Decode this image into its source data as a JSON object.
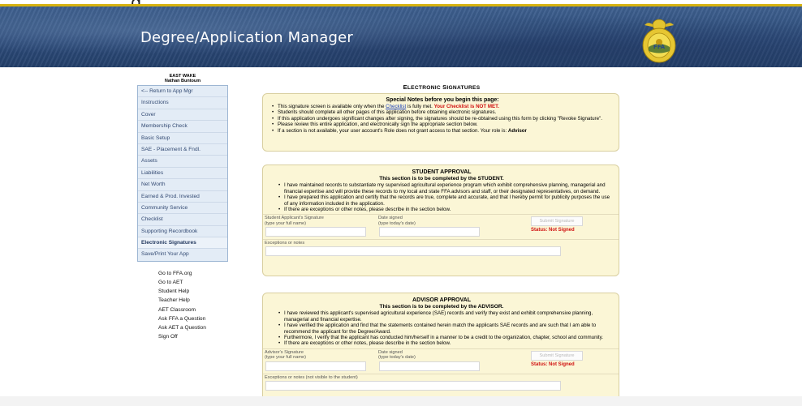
{
  "browser": {
    "title_fragment": "g"
  },
  "header": {
    "title": "Degree/Application Manager",
    "emblem": "ffa-emblem"
  },
  "sidebar": {
    "school": "EAST WAKE",
    "person": "Nathan Buntoum",
    "items": [
      {
        "label": "<-- Return to App Mgr"
      },
      {
        "label": "Instructions"
      },
      {
        "label": "Cover"
      },
      {
        "label": "Membership Check"
      },
      {
        "label": "Basic Setup"
      },
      {
        "label": "SAE - Placement & Fndl."
      },
      {
        "label": "Assets"
      },
      {
        "label": "Liabilities"
      },
      {
        "label": "Net Worth"
      },
      {
        "label": "Earned & Prod. Invested"
      },
      {
        "label": "Community Service"
      },
      {
        "label": "Checklist"
      },
      {
        "label": "Supporting Recordbook"
      },
      {
        "label": "Electronic Signatures",
        "active": true
      },
      {
        "label": "Save/Print Your App"
      }
    ],
    "links": [
      {
        "label": "Go to FFA.org"
      },
      {
        "label": "Go to AET"
      },
      {
        "label": "Student Help"
      },
      {
        "label": "Teacher Help"
      },
      {
        "label": "AET Classroom"
      },
      {
        "label": "Ask FFA a Question"
      },
      {
        "label": "Ask AET a Question"
      },
      {
        "label": "Sign Off"
      }
    ]
  },
  "main": {
    "title_first": "E",
    "title_rest": "LECTRONIC ",
    "title_first2": "S",
    "title_rest2": "IGNATURES",
    "notes": {
      "heading": "Special Notes before you begin this page:",
      "b1_pre": "This signature screen is available only when the ",
      "b1_link": "Checklist",
      "b1_mid": " is fully met. ",
      "b1_red": "Your Checklist is NOT MET.",
      "b2": "Students should complete all other pages of this application before obtaining electronic signatures.",
      "b3": "If this application undergoes significant changes after signing, the signatures should be re-obtained using this form by clicking \"Revoke Signature\".",
      "b4": "Please review this entire application, and electronically sign the appropriate section below.",
      "b5_pre": "If a section is not available, your user account's Role does not grant access to that section. Your role is: ",
      "b5_role": "Advisor"
    },
    "student": {
      "heading": "STUDENT APPROVAL",
      "sub": "This section is to be completed by the STUDENT.",
      "b1": "I have maintained records to substantiate my supervised agricultural experience program which exhibit comprehensive planning, managerial and financial expertise and will provide these records to my local and state FFA advisors and staff, or their designated representatives, on demand.",
      "b2": "I have prepared this application and certify that the records are true, complete and accurate, and that I hereby permit for publicity purposes the use of any information included in the application.",
      "b3": "If there are exceptions or other notes, please describe in the section below.",
      "sig_label1": "Student Applicant's Signature",
      "sig_label2": "(type your full name)",
      "date_label1": "Date signed",
      "date_label2": "(type today's date)",
      "submit": "Submit Signature",
      "status": "Status: Not Signed",
      "notes_label": "Exceptions or notes"
    },
    "advisor": {
      "heading": "ADVISOR APPROVAL",
      "sub": "This section is to be completed by the ADVISOR.",
      "b1": "I have reviewed this applicant's supervised agricultural experience (SAE) records and verify they exist and exhibit comprehensive planning, managerial and financial expertise.",
      "b2": "I have verified the application and find that the statements contained herein match the applicants SAE records and are such that I am able to recommend the applicant for the Degree/Award.",
      "b3": "Furthermore, I verify that the applicant has conducted him/herself in a manner to be a credit to the organization, chapter, school and community.",
      "b4": "If there are exceptions or other notes, please describe in the section below.",
      "sig_label1": "Advisor's Signature",
      "sig_label2": "(type your full name)",
      "date_label1": "Date signed",
      "date_label2": "(type today's date)",
      "submit": "Submit Signature",
      "status": "Status: Not Signed",
      "notes_label": "Exceptions or notes (not visible to the student)"
    }
  },
  "colors": {
    "banner": "#2d4c7b",
    "gold": "#d6b20f",
    "note_bg": "#fbf6d6",
    "status_red": "#d01010",
    "nav_bg": "#e3ecf6"
  }
}
